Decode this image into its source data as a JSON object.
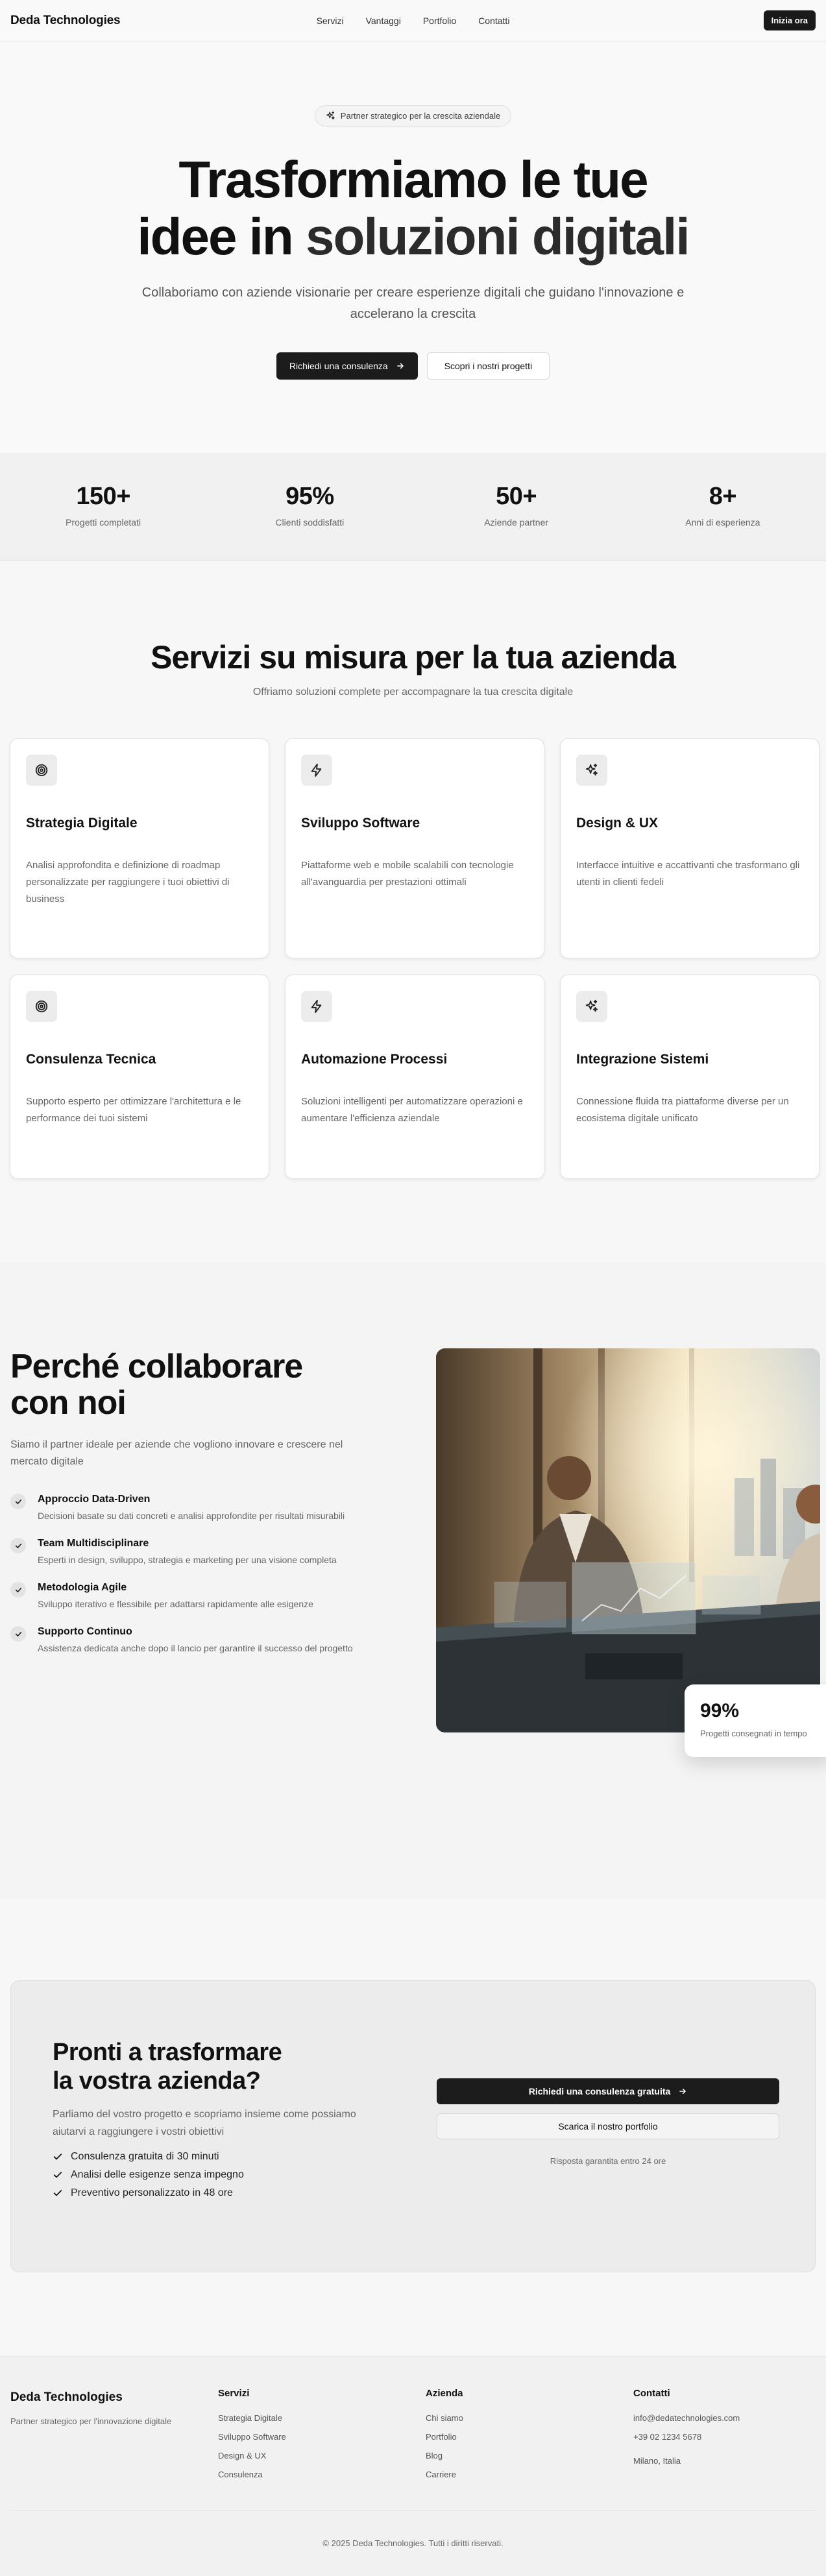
{
  "nav": {
    "brand": "Deda Technologies",
    "links": [
      "Servizi",
      "Vantaggi",
      "Portfolio",
      "Contatti"
    ],
    "cta": "Inizia ora"
  },
  "hero": {
    "pill": "Partner strategico per la crescita aziendale",
    "title_line1": "Trasformiamo le tue",
    "title_line2a": "idee in ",
    "title_line2b": "soluzioni digitali",
    "subtitle": "Collaboriamo con aziende visionarie per creare esperienze digitali che guidano l'innovazione e accelerano la crescita",
    "primary_cta": "Richiedi una consulenza",
    "secondary_cta": "Scopri i nostri progetti"
  },
  "stats": [
    {
      "value": "150+",
      "label": "Progetti completati"
    },
    {
      "value": "95%",
      "label": "Clienti soddisfatti"
    },
    {
      "value": "50+",
      "label": "Aziende partner"
    },
    {
      "value": "8+",
      "label": "Anni di esperienza"
    }
  ],
  "services": {
    "title": "Servizi su misura per la tua azienda",
    "subtitle": "Offriamo soluzioni complete per accompagnare la tua crescita digitale",
    "cards": [
      {
        "icon": "target-icon",
        "title": "Strategia Digitale",
        "desc": "Analisi approfondita e definizione di roadmap personalizzate per raggiungere i tuoi obiettivi di business"
      },
      {
        "icon": "bolt-icon",
        "title": "Sviluppo Software",
        "desc": "Piattaforme web e mobile scalabili con tecnologie all'avanguardia per prestazioni ottimali"
      },
      {
        "icon": "sparkles-icon",
        "title": "Design & UX",
        "desc": "Interfacce intuitive e accattivanti che trasformano gli utenti in clienti fedeli"
      },
      {
        "icon": "target-icon",
        "title": "Consulenza Tecnica",
        "desc": "Supporto esperto per ottimizzare l'architettura e le performance dei tuoi sistemi"
      },
      {
        "icon": "bolt-icon",
        "title": "Automazione Processi",
        "desc": "Soluzioni intelligenti per automatizzare operazioni e aumentare l'efficienza aziendale"
      },
      {
        "icon": "sparkles-icon",
        "title": "Integrazione Sistemi",
        "desc": "Connessione fluida tra piattaforme diverse per un ecosistema digitale unificato"
      }
    ]
  },
  "why": {
    "title_line1": "Perché collaborare",
    "title_line2": "con noi",
    "subtitle": "Siamo il partner ideale per aziende che vogliono innovare e crescere nel mercato digitale",
    "features": [
      {
        "title": "Approccio Data-Driven",
        "desc": "Decisioni basate su dati concreti e analisi approfondite per risultati misurabili"
      },
      {
        "title": "Team Multidisciplinare",
        "desc": "Esperti in design, sviluppo, strategia e marketing per una visione completa"
      },
      {
        "title": "Metodologia Agile",
        "desc": "Sviluppo iterativo e flessibile per adattarsi rapidamente alle esigenze"
      },
      {
        "title": "Supporto Continuo",
        "desc": "Assistenza dedicata anche dopo il lancio per garantire il successo del progetto"
      }
    ],
    "badge_value": "99%",
    "badge_label": "Progetti consegnati in tempo"
  },
  "cta": {
    "title_line1": "Pronti a trasformare",
    "title_line2": "la vostra azienda?",
    "subtitle": "Parliamo del vostro progetto e scopriamo insieme come possiamo aiutarvi a raggiungere i vostri obiettivi",
    "items": [
      "Consulenza gratuita di 30 minuti",
      "Analisi delle esigenze senza impegno",
      "Preventivo personalizzato in 48 ore"
    ],
    "primary": "Richiedi una consulenza gratuita",
    "secondary": "Scarica il nostro portfolio",
    "note": "Risposta garantita entro 24 ore"
  },
  "footer": {
    "brand": "Deda Technologies",
    "tagline": "Partner strategico per l'innovazione digitale",
    "col_services": {
      "title": "Servizi",
      "links": [
        "Strategia Digitale",
        "Sviluppo Software",
        "Design & UX",
        "Consulenza"
      ]
    },
    "col_company": {
      "title": "Azienda",
      "links": [
        "Chi siamo",
        "Portfolio",
        "Blog",
        "Carriere"
      ]
    },
    "col_contact": {
      "title": "Contatti",
      "links": [
        "info@dedatechnologies.com",
        "+39 02 1234 5678",
        "Milano, Italia"
      ]
    },
    "copyright": "© 2025 Deda Technologies. Tutti i diritti riservati."
  }
}
